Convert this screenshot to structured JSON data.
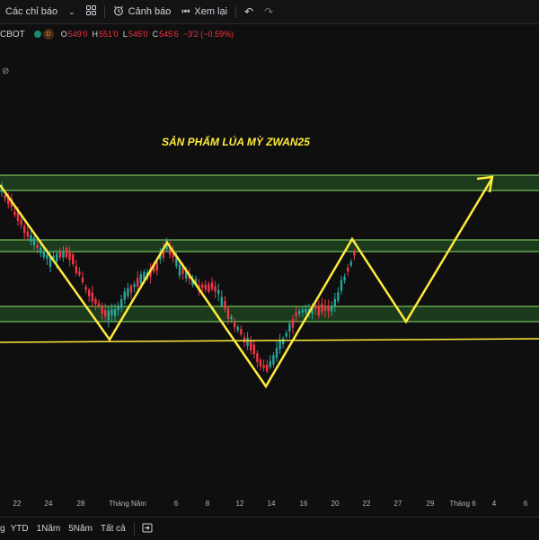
{
  "toolbar": {
    "indicators_label": "Các chỉ báo",
    "alert_label": "Cảnh báo",
    "replay_label": "Xem lại"
  },
  "symbol": {
    "name": "CBOT",
    "badge": "D",
    "open_key": "O",
    "open": "549'0",
    "high_key": "H",
    "high": "551'0",
    "low_key": "L",
    "low": "545'0",
    "close_key": "C",
    "close": "545'6",
    "change": "−3'2 (−0.59%)"
  },
  "annotation": {
    "title": "SẢN PHẨM LÚA MỲ ZWAN25"
  },
  "x_axis": {
    "labels": [
      "22",
      "24",
      "28",
      "Tháng Năm",
      "6",
      "8",
      "12",
      "14",
      "16",
      "20",
      "22",
      "27",
      "29",
      "Tháng 6",
      "4",
      "6"
    ]
  },
  "range_bar": {
    "partial": "g",
    "ytd": "YTD",
    "one_year": "1Năm",
    "five_year": "5Năm",
    "all": "Tất cả"
  },
  "colors": {
    "background": "#0f0f0f",
    "up": "#26a69a",
    "down": "#f23645",
    "zone_line": "#8be36b",
    "zone_fill": "#1c3a1c",
    "annotation": "#ffeb3b"
  },
  "icons": [
    "chevron-down-icon",
    "layout-grid-icon",
    "alarm-clock-icon",
    "replay-icon",
    "undo-icon",
    "redo-icon",
    "eye-off-icon",
    "go-to-date-icon"
  ]
}
